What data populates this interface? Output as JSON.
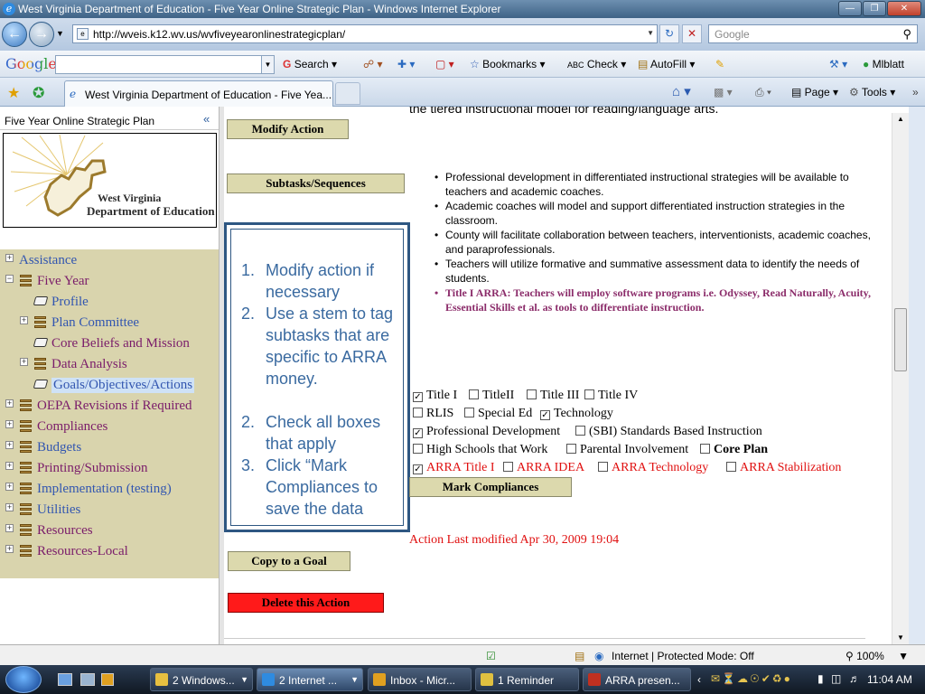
{
  "window": {
    "title": "West Virginia Department of Education - Five Year Online Strategic Plan - Windows Internet Explorer",
    "address": "http://wveis.k12.wv.us/wvfiveyearonlinestrategicplan/",
    "search_placeholder": "Google"
  },
  "google_toolbar": {
    "logo": "Google",
    "search": "Search",
    "bookmarks": "Bookmarks",
    "check": "Check",
    "autofill": "AutoFill",
    "user": "Mlblatt"
  },
  "tabs": {
    "active_title": "West Virginia Department of Education - Five Yea...",
    "page": "Page",
    "tools": "Tools"
  },
  "sidebar": {
    "title": "Five Year Online Strategic Plan",
    "collapse": "«",
    "logo": {
      "line1": "West Virginia",
      "line2": "Department of Education"
    },
    "items": [
      {
        "label": "Assistance",
        "level": 0,
        "icon": "none",
        "color": "#3256b0"
      },
      {
        "label": "Five Year",
        "level": 0,
        "icon": "book",
        "color": "#7a1c6a"
      },
      {
        "label": "Profile",
        "level": 1,
        "icon": "doc",
        "color": "#3256b0"
      },
      {
        "label": "Plan Committee",
        "level": 1,
        "icon": "book",
        "color": "#3256b0"
      },
      {
        "label": "Core Beliefs and Mission",
        "level": 1,
        "icon": "doc",
        "color": "#7a1c6a"
      },
      {
        "label": "Data Analysis",
        "level": 1,
        "icon": "book",
        "color": "#7a1c6a"
      },
      {
        "label": "Goals/Objectives/Actions",
        "level": 1,
        "icon": "doc",
        "color": "#3256b0"
      },
      {
        "label": "OEPA Revisions if Required",
        "level": 0,
        "icon": "book",
        "color": "#7a1c6a"
      },
      {
        "label": "Compliances",
        "level": 0,
        "icon": "book",
        "color": "#7a1c6a"
      },
      {
        "label": "Budgets",
        "level": 0,
        "icon": "book",
        "color": "#3256b0"
      },
      {
        "label": "Printing/Submission",
        "level": 0,
        "icon": "book",
        "color": "#7a1c6a"
      },
      {
        "label": "Implementation (testing)",
        "level": 0,
        "icon": "book",
        "color": "#3256b0"
      },
      {
        "label": "Utilities",
        "level": 0,
        "icon": "book",
        "color": "#3256b0"
      },
      {
        "label": "Resources",
        "level": 0,
        "icon": "book",
        "color": "#7a1c6a"
      },
      {
        "label": "Resources-Local",
        "level": 0,
        "icon": "book",
        "color": "#7a1c6a"
      }
    ]
  },
  "main": {
    "clipped_top": "the tiered instructional model for reading/language arts.",
    "buttons": {
      "modify": "Modify Action",
      "subtasks": "Subtasks/Sequences",
      "mark": "Mark Compliances",
      "copy": "Copy to a Goal",
      "delete": "Delete this Action"
    },
    "steps": [
      {
        "n": "1.",
        "text": "Modify action if necessary"
      },
      {
        "n": "2.",
        "text": "Use a stem to tag subtasks that are specific to ARRA money."
      },
      {
        "n": "2.",
        "text": "Check all boxes that apply"
      },
      {
        "n": "3.",
        "text": "Click “Mark Compliances to save the data"
      }
    ],
    "bullets": [
      "Professional development in differentiated instructional strategies will be available to teachers and academic coaches.",
      "Academic coaches will model and support differentiated instruction strategies in the classroom.",
      "County will facilitate collaboration between teachers, interventionists, academic coaches, and paraprofessionals.",
      "Teachers will utilize formative and summative assessment data to identify the needs of students.",
      "Title I ARRA: Teachers will employ software programs i.e. Odyssey, Read Naturally, Acuity, Essential Skills et al. as tools to differentiate instruction."
    ],
    "compliances": [
      [
        {
          "label": "Title I",
          "checked": true
        },
        {
          "label": "TitleII",
          "checked": false
        },
        {
          "label": "Title III",
          "checked": false
        },
        {
          "label": "Title IV",
          "checked": false
        }
      ],
      [
        {
          "label": "RLIS",
          "checked": false
        },
        {
          "label": "Special Ed",
          "checked": false
        },
        {
          "label": "Technology",
          "checked": true
        }
      ],
      [
        {
          "label": "Professional Development",
          "checked": true
        },
        {
          "label": "(SBI) Standards Based Instruction",
          "checked": false
        }
      ],
      [
        {
          "label": "High Schools that Work",
          "checked": false
        },
        {
          "label": "Parental Involvement",
          "checked": false
        },
        {
          "label": "Core Plan",
          "checked": false
        }
      ],
      [
        {
          "label": "ARRA Title I",
          "checked": true
        },
        {
          "label": "ARRA IDEA",
          "checked": false
        },
        {
          "label": "ARRA Technology",
          "checked": false
        },
        {
          "label": "ARRA Stabilization",
          "checked": false
        }
      ]
    ],
    "last_modified": "Action Last modified Apr 30, 2009 19:04"
  },
  "statusbar": {
    "zone": "Internet | Protected Mode: Off",
    "zoom": "100%"
  },
  "taskbar": {
    "items": [
      "2 Windows...",
      "2 Internet ...",
      "Inbox - Micr...",
      "1 Reminder",
      "ARRA presen..."
    ],
    "clock": "11:04 AM"
  }
}
